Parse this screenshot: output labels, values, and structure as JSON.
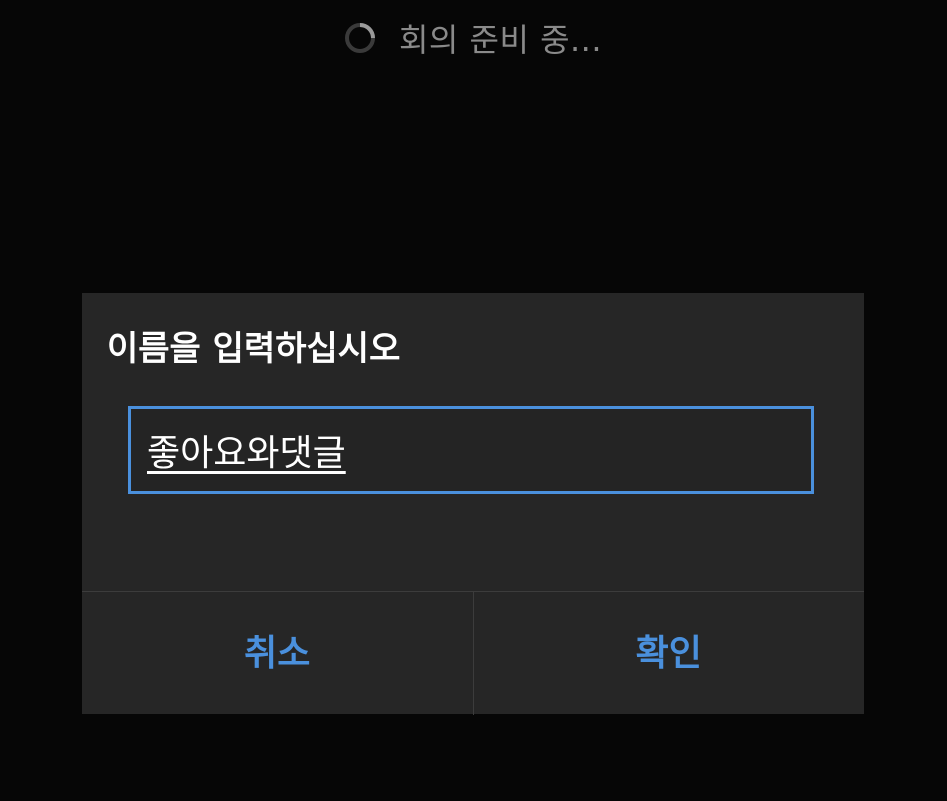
{
  "status": {
    "icon": "loading-spinner-icon",
    "text": "회의 준비 중..."
  },
  "dialog": {
    "title": "이름을 입력하십시오",
    "input_value": "좋아요와댓글",
    "cancel_label": "취소",
    "confirm_label": "확인"
  },
  "colors": {
    "background": "#060606",
    "dialog_background": "#262626",
    "accent": "#4a90dd",
    "status_text": "#8a8a8a",
    "title_text": "#ffffff"
  }
}
